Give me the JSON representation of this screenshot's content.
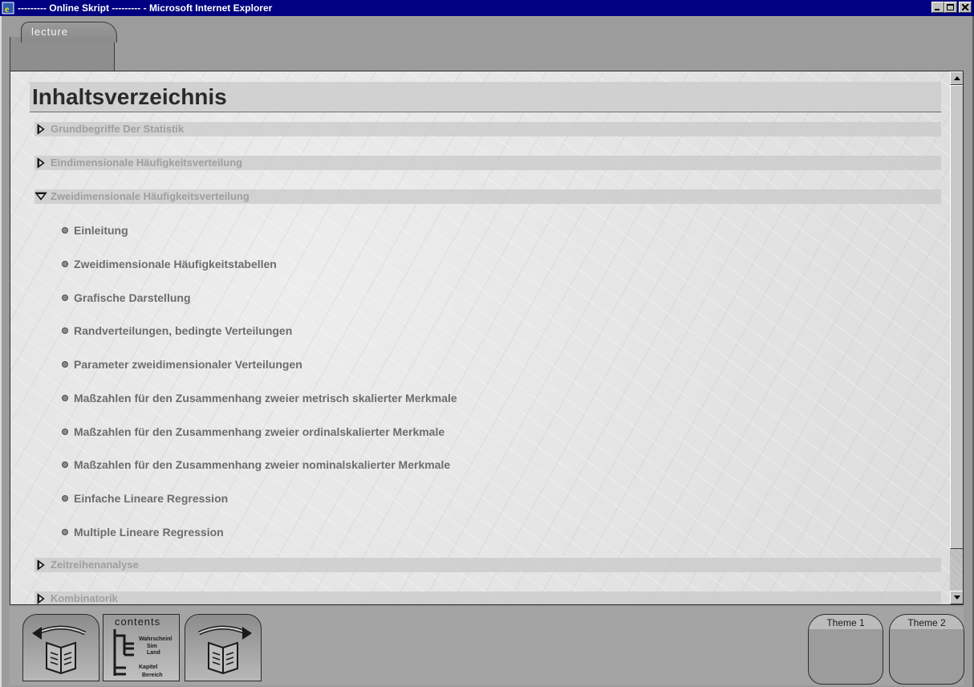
{
  "window": {
    "title": "--------- Online Skript --------- - Microsoft Internet Explorer"
  },
  "tab": {
    "label": "lecture"
  },
  "heading": "Inhaltsverzeichnis",
  "sections": [
    {
      "label": "Grundbegriffe Der Statistik",
      "expanded": false
    },
    {
      "label": "Eindimensionale Häufigkeitsverteilung",
      "expanded": false
    },
    {
      "label": "Zweidimensionale Häufigkeitsverteilung",
      "expanded": true
    },
    {
      "label": "Zeitreihenanalyse",
      "expanded": false
    },
    {
      "label": "Kombinatorik",
      "expanded": false
    }
  ],
  "subitems": [
    "Einleitung",
    "Zweidimensionale Häufigkeitstabellen",
    "Grafische Darstellung",
    "Randverteilungen, bedingte Verteilungen",
    "Parameter zweidimensionaler Verteilungen",
    "Maßzahlen für den Zusammenhang zweier metrisch skalierter Merkmale",
    "Maßzahlen für den Zusammenhang zweier ordinalskalierter Merkmale",
    "Maßzahlen für den Zusammenhang zweier nominalskalierter Merkmale",
    "Einfache Lineare Regression",
    "Multiple Lineare Regression"
  ],
  "bottom": {
    "contents_label": "contents",
    "contents_tree": [
      "Wahrscheinl",
      "Sim",
      "Land",
      "Kapitel",
      "Bereich"
    ],
    "theme1": "Theme 1",
    "theme2": "Theme 2"
  },
  "colors": {
    "titlebar": "#000080",
    "section_text": "#9e9e9e",
    "item_text": "#6c6c6c"
  }
}
